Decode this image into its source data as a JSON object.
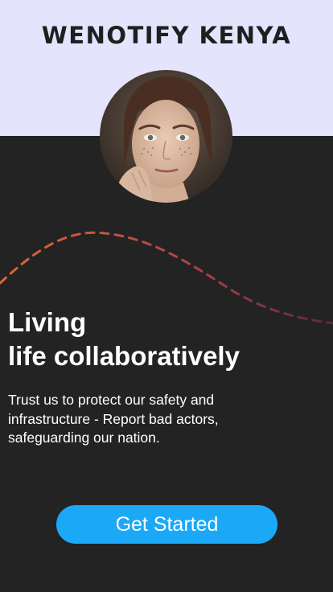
{
  "brand": {
    "name": "WENOTIFY KENYA",
    "band_color": "#e4e4fd"
  },
  "hero": {
    "avatar_icon": "user-portrait-photo",
    "wave_colors": [
      "#e0643a",
      "#b0444a",
      "#5a2a3a"
    ]
  },
  "headline": {
    "line1": "Living",
    "line2": "life collaboratively"
  },
  "subtext": "Trust us to protect our safety and infrastructure - Report bad actors, safeguarding our nation.",
  "cta": {
    "label": "Get Started",
    "color": "#1ba8f7"
  },
  "theme": {
    "background": "#232323",
    "text": "#ffffff"
  }
}
